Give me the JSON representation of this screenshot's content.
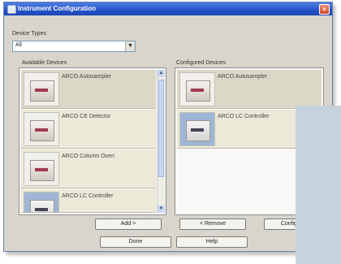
{
  "window": {
    "title": "Instrument Configuration",
    "close_glyph": "×"
  },
  "device_types": {
    "label": "Device Types",
    "selected": "All"
  },
  "available": {
    "label": "Available Devices",
    "items": [
      {
        "name": "ARCO Autosampler",
        "icon": "autosampler-icon"
      },
      {
        "name": "ARCO CE Detector",
        "icon": "ce-detector-icon"
      },
      {
        "name": "ARCO Column Oven",
        "icon": "column-oven-icon"
      },
      {
        "name": "ARCO LC Controller",
        "icon": "lc-controller-icon"
      }
    ]
  },
  "configured": {
    "label": "Configured Devices",
    "items": [
      {
        "name": "ARCO Autosampler",
        "icon": "autosampler-icon"
      },
      {
        "name": "ARCO LC Controller",
        "icon": "lc-controller-icon"
      }
    ]
  },
  "buttons": {
    "add": "Add >",
    "remove": "< Remove",
    "configure": "Configure",
    "done": "Done",
    "help": "Help"
  }
}
